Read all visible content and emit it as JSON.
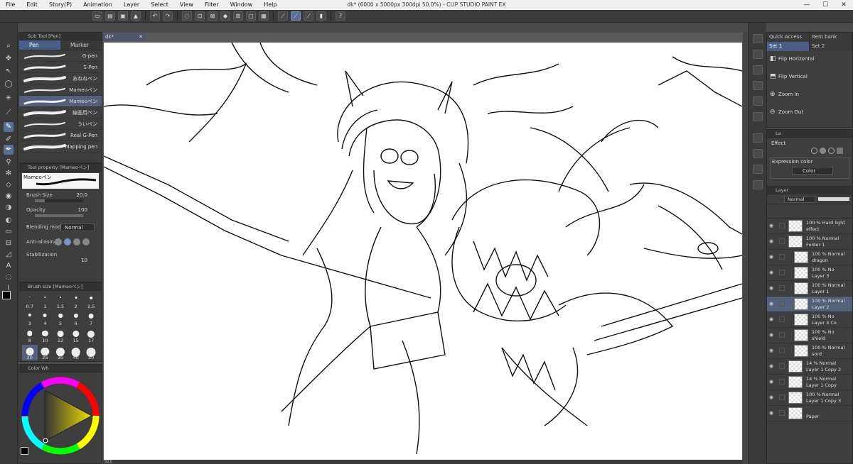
{
  "window": {
    "title": "dk* (6000 x 5000px 300dpi 50.0%) - CLIP STUDIO PAINT EX",
    "controls": [
      "—",
      "☐",
      "✕"
    ]
  },
  "menu": [
    "File",
    "Edit",
    "Story(P)",
    "Animation",
    "Layer",
    "Select",
    "View",
    "Filter",
    "Window",
    "Help"
  ],
  "document": {
    "tab_label": "dk*",
    "zoom": "50.0"
  },
  "subtool": {
    "header": "Sub Tool [Pen]",
    "tabs": [
      "Pen",
      "Marker"
    ],
    "brushes": [
      "G-pen",
      "S-Pen",
      "あねねペン",
      "Mameoペン",
      "Mameoペン",
      "線画用ペン",
      "ういペン",
      "Real G-Pen",
      "Mapping pen"
    ],
    "selected_index": 4
  },
  "toolprop": {
    "header": "Tool property [Mameoペン]",
    "brush_name": "Mameoペン",
    "brush_size_label": "Brush Size",
    "brush_size_value": "20.0",
    "brush_size_fraction": 0.2,
    "opacity_label": "Opacity",
    "opacity_value": "100",
    "opacity_fraction": 1.0,
    "blending_label": "Blending mode",
    "blending_value": "Normal",
    "antialias_label": "Anti-aliasing",
    "stabilization_label": "Stabilization",
    "stabilization_value": "10"
  },
  "brushsize": {
    "header": "Brush size [Mameoペン]",
    "sizes": [
      "0.7",
      "1",
      "1.5",
      "2",
      "2.5",
      "3",
      "4",
      "5",
      "6",
      "7",
      "8",
      "10",
      "12",
      "15",
      "17",
      "20",
      "25",
      "30",
      "40",
      "50"
    ],
    "selected_index": 15
  },
  "colorwheel": {
    "header": "Color Wh",
    "main_color": "#000000",
    "sub_color": "#ffffff"
  },
  "quickaccess": {
    "tabs": [
      "Quick Access",
      "Item bank"
    ],
    "set_tabs": [
      "Set 1",
      "Set 2"
    ],
    "items": [
      "Flip Horizontal",
      "Flip Vertical",
      "Zoom In",
      "Zoom Out"
    ]
  },
  "subview": {
    "tab_label": "La",
    "effect_label": "Effect",
    "expression_label": "Expression color",
    "expression_value": "Color"
  },
  "layers": {
    "header": "Layer",
    "blend_mode": "Normal",
    "items": [
      {
        "mode": "100 % Hard light",
        "name": "effect"
      },
      {
        "mode": "100 % Normal",
        "name": "Folder 1"
      },
      {
        "mode": "100 % Normal",
        "name": "dragon"
      },
      {
        "mode": "100 % No",
        "name": "Layer 3"
      },
      {
        "mode": "100 % Normal",
        "name": "Layer 1"
      },
      {
        "mode": "100 % Normal",
        "name": "Layer 2"
      },
      {
        "mode": "100 % No",
        "name": "Layer 4 Co"
      },
      {
        "mode": "100 % No",
        "name": "shield"
      },
      {
        "mode": "100 % Normal",
        "name": "sord"
      },
      {
        "mode": "14 % Normal",
        "name": "Layer 1 Copy 2"
      },
      {
        "mode": "14 % Normal",
        "name": "Layer 1 Copy"
      },
      {
        "mode": "100 % Normal",
        "name": "Layer 1 Copy 3"
      },
      {
        "mode": "",
        "name": "Paper"
      }
    ],
    "selected_index": 5
  },
  "colors": {
    "accent": "#4b5f86",
    "selected_row": "#56607a",
    "panel_bg": "#3e3e3e"
  }
}
